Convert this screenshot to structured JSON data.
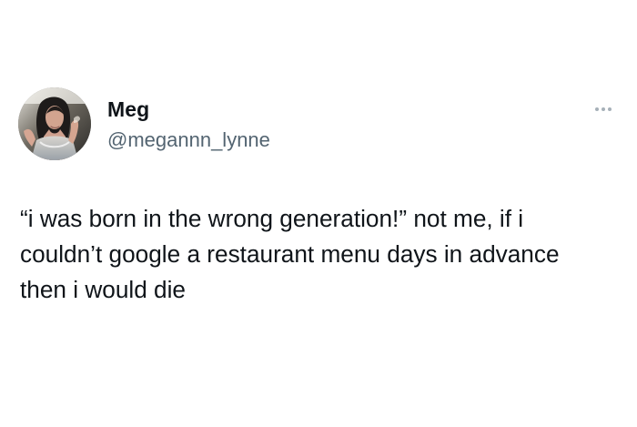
{
  "author": {
    "display_name": "Meg",
    "handle": "@megannn_lynne",
    "avatar_icon": "profile-photo"
  },
  "tweet": {
    "text": "“i was born in the wrong generation!” not me, if i couldn’t google a restaurant menu days in advance then i would die"
  },
  "menu": {
    "icon": "more-horizontal-icon"
  },
  "colors": {
    "text": "#0f1419",
    "secondary_text": "#536471",
    "more_dots": "#a6b0b8",
    "background": "#ffffff"
  }
}
